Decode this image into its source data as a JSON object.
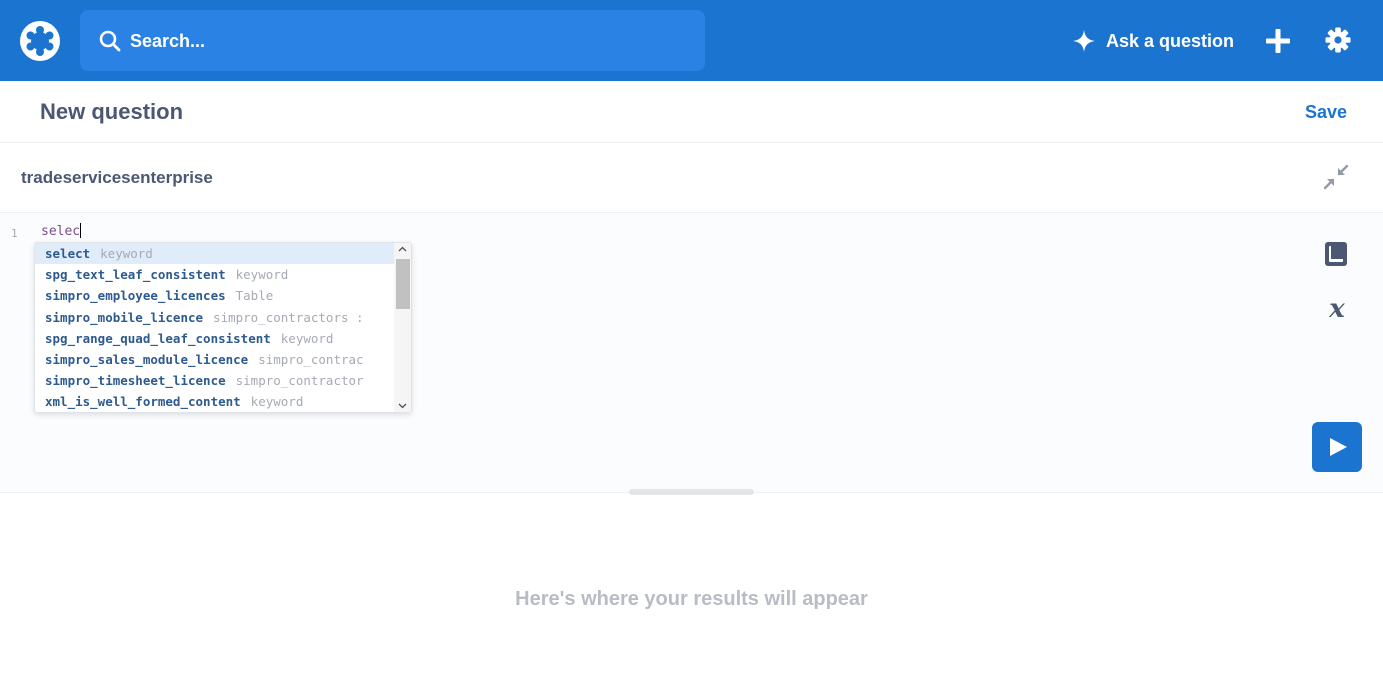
{
  "nav": {
    "search_placeholder": "Search...",
    "ask_label": "Ask a question"
  },
  "question": {
    "title": "New question",
    "save_label": "Save"
  },
  "database": {
    "name": "tradeservicesenterprise"
  },
  "editor": {
    "line_number": "1",
    "code": "selec"
  },
  "autocomplete": [
    {
      "name": "select",
      "meta": "keyword"
    },
    {
      "name": "spg_text_leaf_consistent",
      "meta": "keyword"
    },
    {
      "name": "simpro_employee_licences",
      "meta": "Table"
    },
    {
      "name": "simpro_mobile_licence",
      "meta": "simpro_contractors :"
    },
    {
      "name": "spg_range_quad_leaf_consistent",
      "meta": "keyword"
    },
    {
      "name": "simpro_sales_module_licence",
      "meta": "simpro_contrac"
    },
    {
      "name": "simpro_timesheet_licence",
      "meta": "simpro_contractor"
    },
    {
      "name": "xml_is_well_formed_content",
      "meta": "keyword"
    }
  ],
  "results": {
    "empty_message": "Here's where your results will appear"
  },
  "icons": {
    "logo": "metabase-logo-icon",
    "search": "search-icon",
    "ask": "sparkle-icon",
    "new": "plus-icon",
    "settings": "gear-icon",
    "collapse": "collapse-icon",
    "reference": "book-icon",
    "variables": "variable-x-icon",
    "run": "play-icon"
  },
  "colors": {
    "brand": "#1c74d1",
    "search_bg": "#2a82e4",
    "text_dark": "#4c5773",
    "text_muted": "#b8bcc4",
    "selection": "#e1ecfb"
  }
}
